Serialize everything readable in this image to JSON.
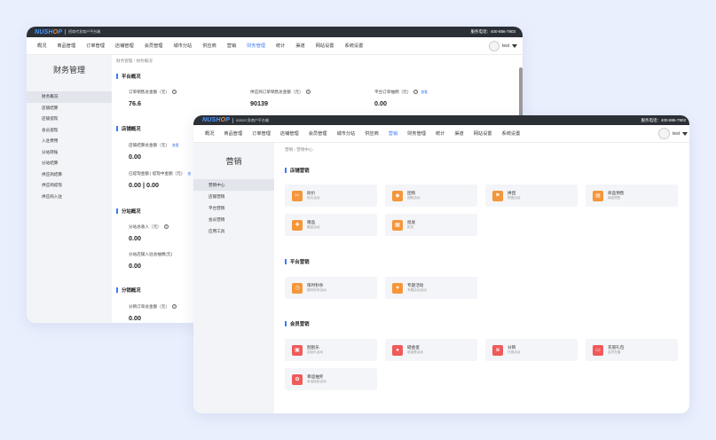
{
  "colors": {
    "accent": "#3b7cf5",
    "orange_icon": "#f5963a",
    "red_icon": "#ef5a5a",
    "topbar": "#2b2f36",
    "background": "#e9effd"
  },
  "back": {
    "logo": "NUSHOP",
    "subtitle": "招商代发商户平台端",
    "hotline": "服务电话：400-886-7903",
    "nav": [
      "概况",
      "商品管理",
      "订单管理",
      "店铺管理",
      "会员管理",
      "城市分站",
      "供应商",
      "营销",
      "财务管理",
      "统计",
      "渠道",
      "网站设置",
      "系统设置"
    ],
    "active_nav": "财务管理",
    "user": "test",
    "side_title": "财务管理",
    "side_items": [
      "财务概况",
      "店铺结算",
      "店铺提现",
      "会员提现",
      "入驻费用",
      "分站转账",
      "分站结算",
      "供应商结算",
      "供应商提现",
      "供应商入驻"
    ],
    "breadcrumb": "财务管理  ›  财务概况",
    "platform": {
      "title": "平台概况",
      "label1": "订单销售总金额（元）",
      "value1": "76.6",
      "label2": "供应商订单销售总金额（元）",
      "value2": "90139",
      "label3": "平台订单抽佣（元）",
      "link3": "查看",
      "value3": "0.00"
    },
    "store": {
      "title": "店铺概况",
      "label1": "店铺结算总金额（元）",
      "link1": "查看",
      "value1": "0.00",
      "label2": "已提现金额 | 提现中金额（元）",
      "link2": "查",
      "value2": "0.00 | 0.00"
    },
    "branch": {
      "title": "分站概况",
      "label1": "分站总收入（元）",
      "value1": "0.00",
      "label2": "分站店铺入驻总抽佣(元)",
      "value2": "0.00"
    },
    "dist": {
      "title": "分销概况",
      "label1": "分销订单总金额（元）",
      "value1": "0.00"
    }
  },
  "front": {
    "logo": "NUSHOP",
    "subtitle": "B2B2C多商户平台端",
    "hotline": "服务电话：400-886-7903",
    "nav": [
      "概况",
      "商品管理",
      "订单管理",
      "店铺管理",
      "会员管理",
      "城市分站",
      "供应商",
      "营销",
      "财务管理",
      "统计",
      "渠道",
      "网站设置",
      "系统设置"
    ],
    "active_nav": "营销",
    "user": "test",
    "side_title": "营销",
    "side_items": [
      "营销中心",
      "店铺营销",
      "平台营销",
      "会员营销",
      "应用工具"
    ],
    "breadcrumb": "营销  ›  营销中心",
    "store_section": "店铺营销",
    "store_cards": [
      {
        "title": "砍价",
        "desc": "砍价活动",
        "icon": "bargain-icon"
      },
      {
        "title": "团购",
        "desc": "团购活动",
        "icon": "groupbuy-icon"
      },
      {
        "title": "拼团",
        "desc": "拼团活动",
        "icon": "pintuan-icon"
      },
      {
        "title": "商品预售",
        "desc": "商品预售",
        "icon": "presale-icon"
      },
      {
        "title": "赠品",
        "desc": "赠品活动",
        "icon": "gift-icon"
      },
      {
        "title": "批发",
        "desc": "批发",
        "icon": "wholesale-icon"
      }
    ],
    "platform_section": "平台营销",
    "platform_cards": [
      {
        "title": "限时秒杀",
        "desc": "限时秒杀活动",
        "icon": "flash-sale-icon"
      },
      {
        "title": "专题活动",
        "desc": "专题活动活动",
        "icon": "topic-icon"
      }
    ],
    "member_section": "会员营销",
    "member_cards": [
      {
        "title": "刮刮乐",
        "desc": "刮刮乐活动",
        "icon": "scratch-icon"
      },
      {
        "title": "砸金蛋",
        "desc": "砸金蛋活动",
        "icon": "golden-egg-icon"
      },
      {
        "title": "分销",
        "desc": "分销活动",
        "icon": "distribution-icon"
      },
      {
        "title": "充值礼包",
        "desc": "会员充值",
        "icon": "recharge-icon"
      },
      {
        "title": "幸运抽奖",
        "desc": "幸运抽奖活动",
        "icon": "lottery-icon"
      }
    ]
  }
}
